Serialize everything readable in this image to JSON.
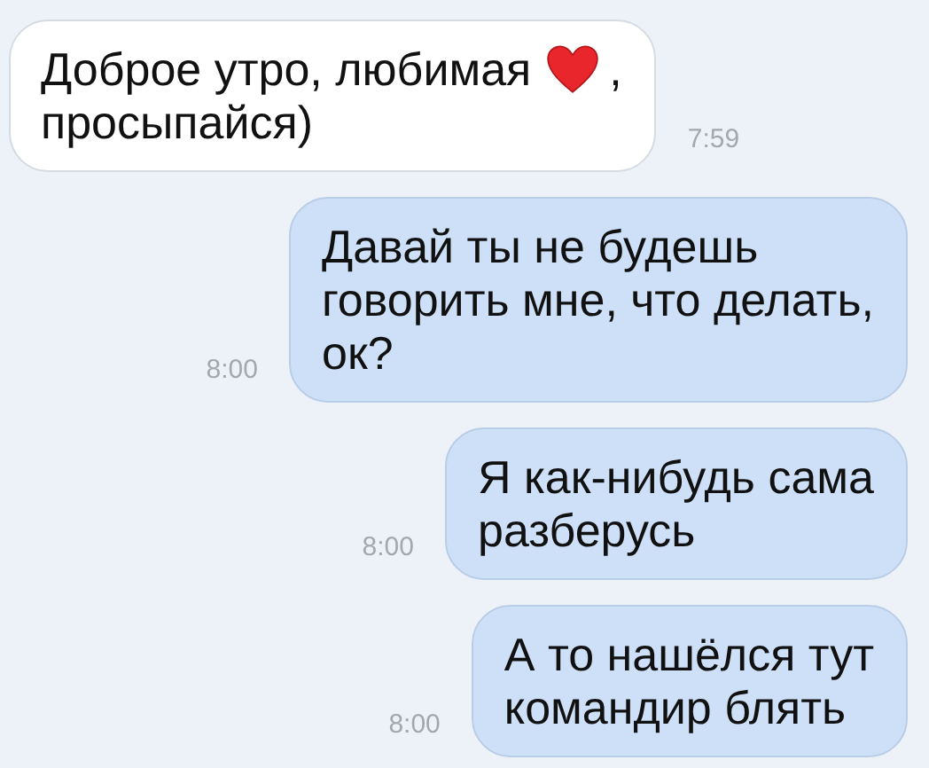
{
  "messages": [
    {
      "kind": "incoming",
      "text": "Доброе утро, любимая",
      "heart": true,
      "text_after": ",",
      "text_next": "просыпайся)",
      "time": "7:59"
    },
    {
      "kind": "outgoing",
      "text": "Давай ты не будешь\nговорить мне, что делать,\nок?",
      "time": "8:00"
    },
    {
      "kind": "outgoing",
      "text": "Я как-нибудь сама\nразберусь",
      "time": "8:00"
    },
    {
      "kind": "outgoing",
      "text": "А то нашёлся тут\nкомандир блять",
      "time": "8:00"
    }
  ]
}
